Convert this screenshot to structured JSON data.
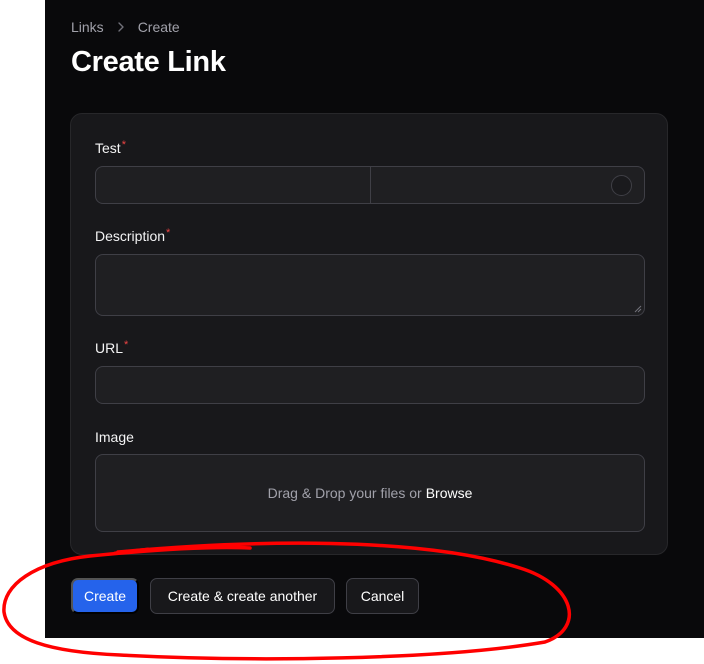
{
  "breadcrumb": {
    "items": [
      "Links",
      "Create"
    ]
  },
  "page": {
    "title": "Create Link"
  },
  "form": {
    "test": {
      "label": "Test",
      "required_mark": "*",
      "value_left": "",
      "value_right": ""
    },
    "description": {
      "label": "Description",
      "required_mark": "*",
      "value": ""
    },
    "url": {
      "label": "URL",
      "required_mark": "*",
      "value": ""
    },
    "image": {
      "label": "Image",
      "dropzone_text": "Drag & Drop your files or",
      "browse_label": "Browse"
    }
  },
  "actions": {
    "create": "Create",
    "create_another": "Create & create another",
    "cancel": "Cancel"
  },
  "colors": {
    "background": "#09090b",
    "card": "#18181b",
    "primary": "#2563eb",
    "required": "#ef4444",
    "annotation": "#ff0000"
  }
}
